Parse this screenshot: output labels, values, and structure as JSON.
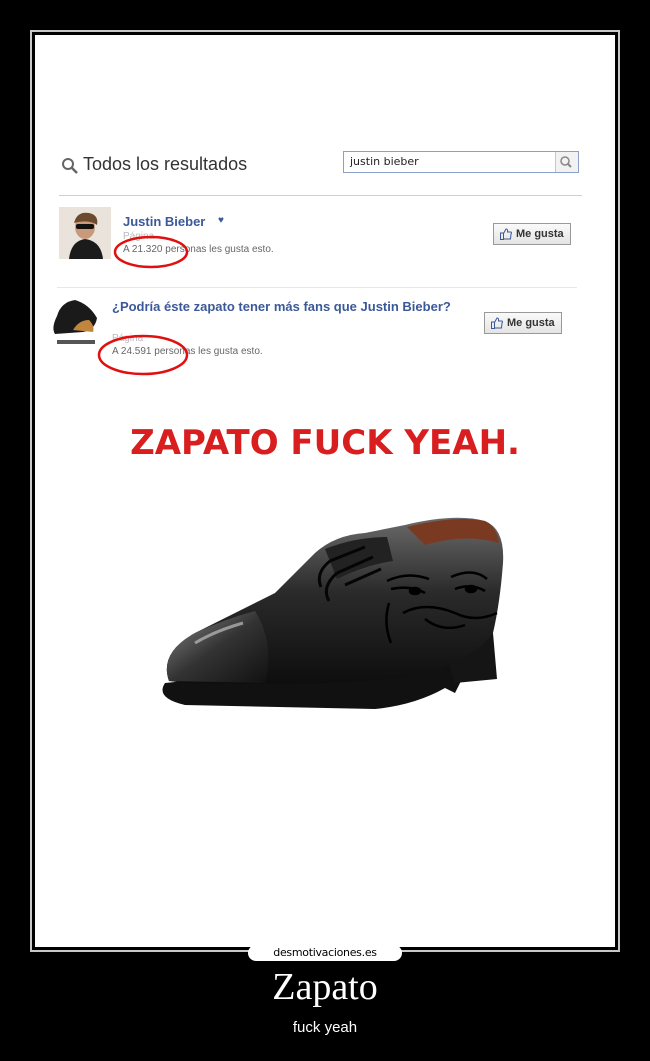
{
  "search": {
    "results_title": "Todos los resultados",
    "query": "justin bieber"
  },
  "results": [
    {
      "title": "Justin Bieber",
      "category": "Página",
      "likes_text": "A 21.320 personas les gusta esto.",
      "like_button": "Me gusta"
    },
    {
      "title": "¿Podría éste zapato tener más fans que Justin Bieber?",
      "category": "Página",
      "likes_text": "A 24.591 personas les gusta esto.",
      "like_button": "Me gusta"
    }
  ],
  "meme": {
    "caption": "ZAPATO FUCK YEAH."
  },
  "watermark": "desmotivaciones.es",
  "poster": {
    "title": "Zapato",
    "subtitle": "fuck yeah"
  },
  "colors": {
    "background": "#000000",
    "link_blue": "#3b5998",
    "caption_red": "#d81e1e",
    "circle_red": "#e01010"
  }
}
